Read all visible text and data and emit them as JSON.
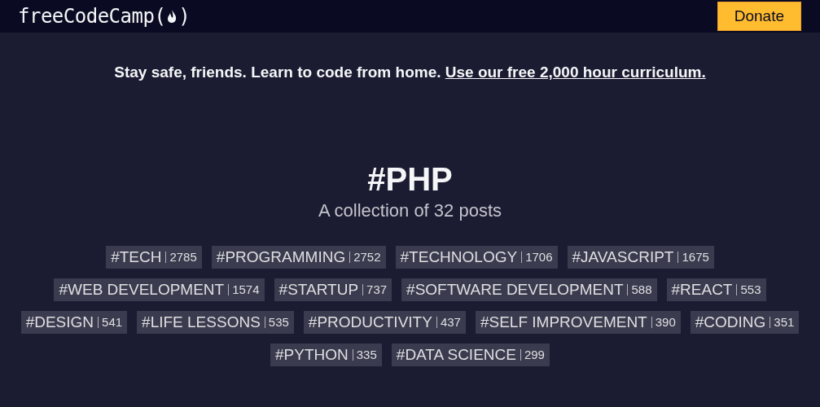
{
  "header": {
    "logo": {
      "name": "freeCodeCamp",
      "open": "(",
      "close": ")"
    },
    "donate_button": "Donate"
  },
  "banner": {
    "text": "Stay safe, friends. Learn to code from home.",
    "link": "Use our free 2,000 hour curriculum."
  },
  "title": "#PHP",
  "subtitle": "A collection of 32 posts",
  "tags": [
    {
      "label": "#TECH",
      "count": "2785"
    },
    {
      "label": "#PROGRAMMING",
      "count": "2752"
    },
    {
      "label": "#TECHNOLOGY",
      "count": "1706"
    },
    {
      "label": "#JAVASCRIPT",
      "count": "1675"
    },
    {
      "label": "#WEB DEVELOPMENT",
      "count": "1574"
    },
    {
      "label": "#STARTUP",
      "count": "737"
    },
    {
      "label": "#SOFTWARE DEVELOPMENT",
      "count": "588"
    },
    {
      "label": "#REACT",
      "count": "553"
    },
    {
      "label": "#DESIGN",
      "count": "541"
    },
    {
      "label": "#LIFE LESSONS",
      "count": "535"
    },
    {
      "label": "#PRODUCTIVITY",
      "count": "437"
    },
    {
      "label": "#SELF IMPROVEMENT",
      "count": "390"
    },
    {
      "label": "#CODING",
      "count": "351"
    },
    {
      "label": "#PYTHON",
      "count": "335"
    },
    {
      "label": "#DATA SCIENCE",
      "count": "299"
    }
  ]
}
